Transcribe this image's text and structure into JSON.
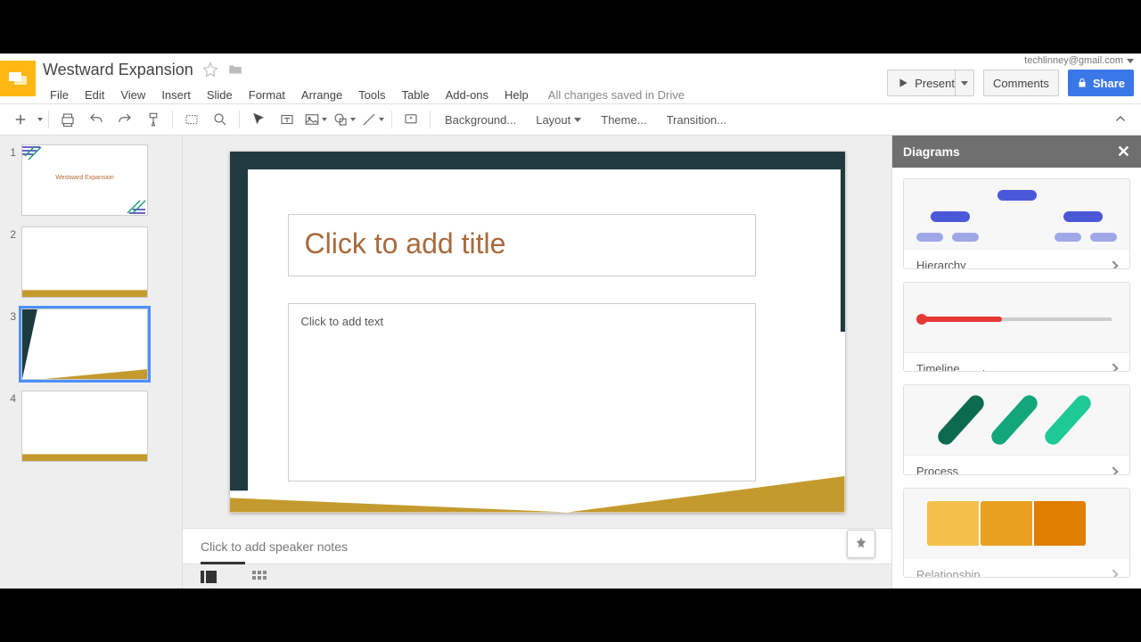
{
  "doc": {
    "title": "Westward Expansion"
  },
  "user": {
    "email": "techlinney@gmail.com"
  },
  "menu": {
    "file": "File",
    "edit": "Edit",
    "view": "View",
    "insert": "Insert",
    "slide": "Slide",
    "format": "Format",
    "arrange": "Arrange",
    "tools": "Tools",
    "table": "Table",
    "addons": "Add-ons",
    "help": "Help"
  },
  "save_status": "All changes saved in Drive",
  "buttons": {
    "present": "Present",
    "comments": "Comments",
    "share": "Share"
  },
  "toolbar": {
    "background": "Background...",
    "layout": "Layout",
    "theme": "Theme...",
    "transition": "Transition..."
  },
  "thumbs": [
    "1",
    "2",
    "3",
    "4"
  ],
  "thumb1_title": "Westward Expansion",
  "slide": {
    "title_placeholder": "Click to add title",
    "body_placeholder": "Click to add text"
  },
  "notes_placeholder": "Click to add speaker notes",
  "sidebar": {
    "title": "Diagrams",
    "items": [
      {
        "label": "Hierarchy"
      },
      {
        "label": "Timeline"
      },
      {
        "label": "Process"
      },
      {
        "label": "Relationship"
      }
    ]
  }
}
